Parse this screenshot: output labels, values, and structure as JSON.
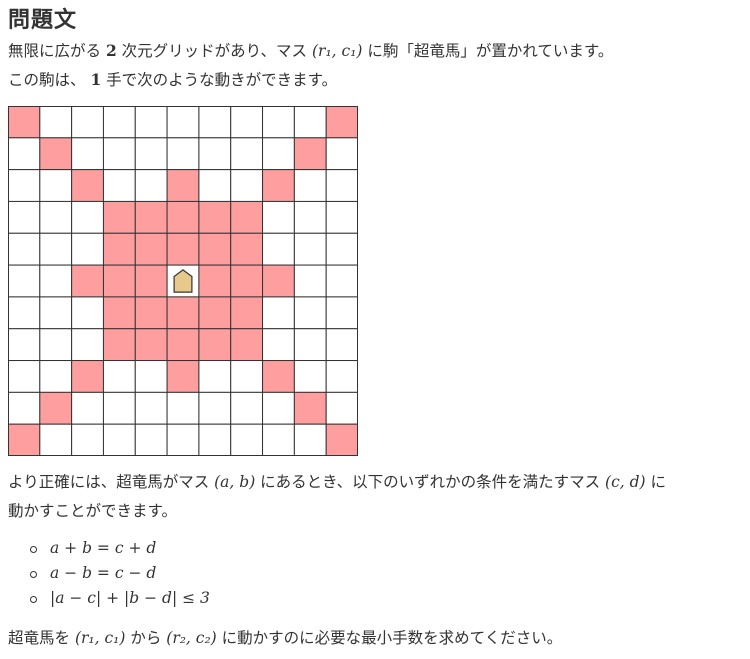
{
  "title": "問題文",
  "intro": {
    "line1": {
      "text_a": "無限に広がる ",
      "num": "2",
      "text_b": " 次元グリッドがあり、マス ",
      "coord": "(r₁, c₁)",
      "text_c": " に駒「超竜馬」が置かれています。"
    },
    "line2": {
      "text_a": "この駒は、 ",
      "num": "1",
      "text_b": " 手で次のような動きができます。"
    }
  },
  "figure": {
    "rows": 11,
    "cols": 11,
    "highlight_color": "#ff9e9e",
    "piece_color": "#e8c98c",
    "piece_icon": "shogi-piece-icon",
    "piece_cell": [
      5,
      5
    ],
    "highlighted_cells": [
      [
        0,
        0
      ],
      [
        0,
        10
      ],
      [
        1,
        1
      ],
      [
        1,
        9
      ],
      [
        2,
        2
      ],
      [
        2,
        5
      ],
      [
        2,
        8
      ],
      [
        3,
        3
      ],
      [
        3,
        4
      ],
      [
        3,
        5
      ],
      [
        3,
        6
      ],
      [
        3,
        7
      ],
      [
        4,
        3
      ],
      [
        4,
        4
      ],
      [
        4,
        5
      ],
      [
        4,
        6
      ],
      [
        4,
        7
      ],
      [
        5,
        2
      ],
      [
        5,
        3
      ],
      [
        5,
        4
      ],
      [
        5,
        6
      ],
      [
        5,
        7
      ],
      [
        5,
        8
      ],
      [
        6,
        3
      ],
      [
        6,
        4
      ],
      [
        6,
        5
      ],
      [
        6,
        6
      ],
      [
        6,
        7
      ],
      [
        7,
        3
      ],
      [
        7,
        4
      ],
      [
        7,
        5
      ],
      [
        7,
        6
      ],
      [
        7,
        7
      ],
      [
        8,
        2
      ],
      [
        8,
        5
      ],
      [
        8,
        8
      ],
      [
        9,
        1
      ],
      [
        9,
        9
      ],
      [
        10,
        0
      ],
      [
        10,
        10
      ]
    ]
  },
  "detail": {
    "line1": {
      "text_a": "より正確には、超竜馬がマス ",
      "coord_ab": "(a, b)",
      "text_b": " にあるとき、以下のいずれかの条件を満たすマス ",
      "coord_cd": "(c, d)",
      "text_c": " に"
    },
    "line2": "動かすことができます。"
  },
  "conditions": [
    "a + b = c + d",
    "a − b = c − d",
    "|a − c| + |b − d| ≤ 3"
  ],
  "question": {
    "text_a": "超竜馬を ",
    "from": "(r₁, c₁)",
    "text_b": " から ",
    "to": "(r₂, c₂)",
    "text_c": " に動かすのに必要な最小手数を求めてください。"
  }
}
